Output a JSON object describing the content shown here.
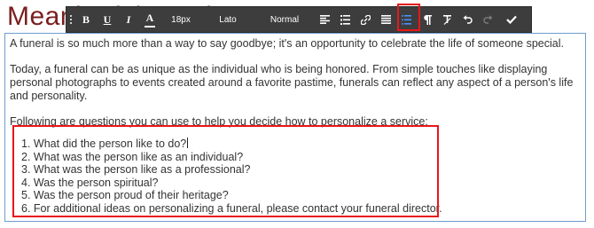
{
  "page": {
    "heading": "Meaningful Services"
  },
  "toolbar": {
    "bold_label": "B",
    "underline_label": "U",
    "italic_label": "I",
    "text_color_label": "A",
    "font_size": "18px",
    "font_family": "Lato",
    "paragraph_format": "Normal",
    "icons": {
      "align": "align-left-icon",
      "list_style": "list-indent-icon",
      "link": "link-icon",
      "align2": "align-justify-icon",
      "numbered_list": "numbered-list-icon",
      "paragraph": "paragraph-icon",
      "clear": "clear-format-icon",
      "undo": "undo-icon",
      "redo": "redo-icon",
      "done": "checkmark-icon"
    },
    "active_button": "numbered_list"
  },
  "editor": {
    "paragraphs": [
      "A funeral is so much more than a way to say goodbye; it's an opportunity to celebrate the life of someone special.",
      "Today, a funeral can be as unique as the individual who is being honored. From simple touches like displaying personal photographs to events created around a favorite pastime, funerals can reflect any aspect of a person's life and personality.",
      "Following are questions you can use to help you decide how to personalize a service:"
    ],
    "list_items": [
      "1. What did the person like to do?",
      "2. What was the person like as an individual?",
      "3. What was the person like as a professional?",
      "4. Was the person spiritual?",
      "5. Was the person proud of their heritage?",
      "6. For additional ideas on personalizing a funeral, please contact your funeral director."
    ]
  },
  "colors": {
    "heading": "#7a1f1f",
    "toolbar_bg": "#3d3d3d",
    "highlight": "#e8161b",
    "active_icon": "#4a90ff",
    "editor_border": "#6f9bd0"
  }
}
